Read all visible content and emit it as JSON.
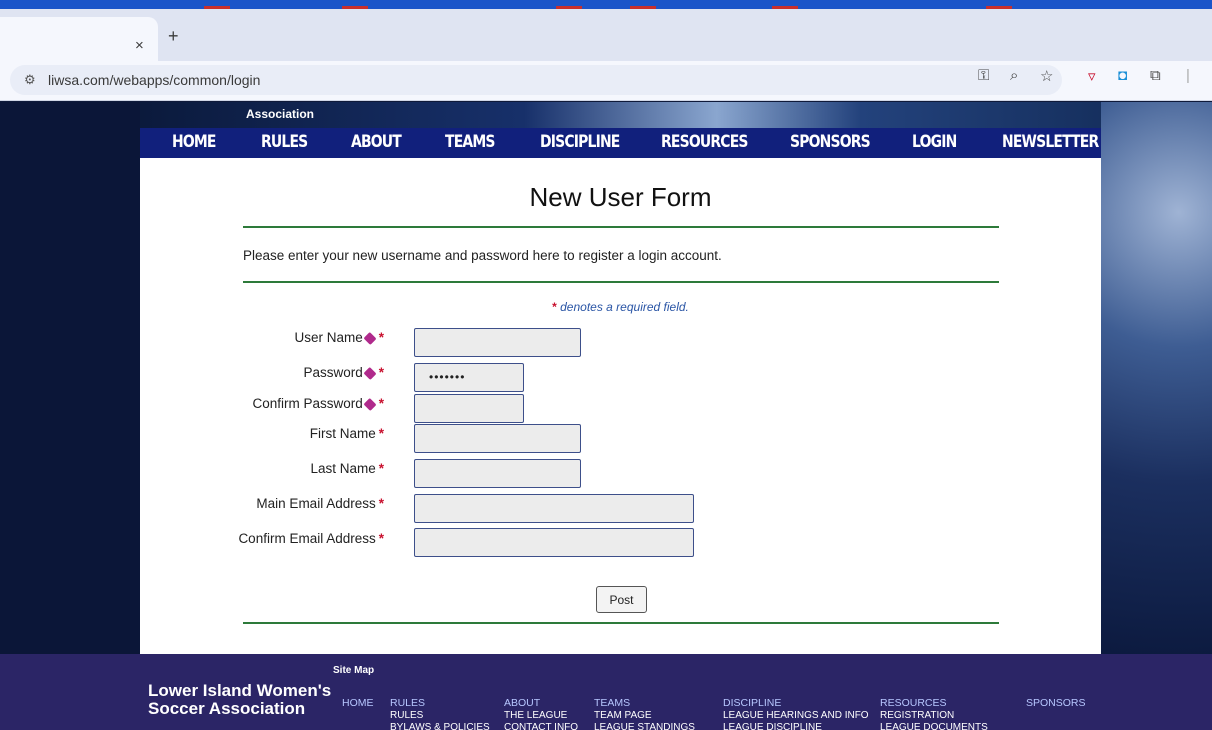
{
  "browser": {
    "url": "liwsa.com/webapps/common/login",
    "tab_close": "×",
    "tab_new": "+"
  },
  "banner": {
    "text": "Association"
  },
  "nav": [
    "HOME",
    "RULES",
    "ABOUT",
    "TEAMS",
    "DISCIPLINE",
    "RESOURCES",
    "SPONSORS",
    "LOGIN",
    "NEWSLETTER"
  ],
  "form": {
    "title": "New User Form",
    "intro": "Please enter your new username and password here to register a login account.",
    "required_note": "denotes a required field.",
    "required_marker": "*",
    "labels": {
      "username": "User Name",
      "password": "Password",
      "confirm_password": "Confirm Password",
      "first_name": "First Name",
      "last_name": "Last Name",
      "email": "Main Email Address",
      "confirm_email": "Confirm Email Address"
    },
    "values": {
      "username": "",
      "password": "•••••••",
      "confirm_password": "",
      "first_name": "",
      "last_name": "",
      "email": "",
      "confirm_email": ""
    },
    "submit": "Post"
  },
  "footer": {
    "site_map": "Site Map",
    "org_line1": "Lower Island Women's",
    "org_line2": "Soccer Association",
    "links": {
      "home": "HOME",
      "rules": "RULES",
      "about": "ABOUT",
      "teams": "TEAMS",
      "discipline": "DISCIPLINE",
      "resources": "RESOURCES",
      "sponsors": "SPONSORS"
    },
    "sub": {
      "rules_1": "RULES",
      "rules_2": "BYLAWS & POLICIES",
      "about_1": "THE LEAGUE",
      "about_2": "CONTACT INFO",
      "teams_1": "TEAM PAGE",
      "teams_2": "LEAGUE STANDINGS",
      "disc_1": "LEAGUE HEARINGS AND INFO",
      "disc_2": "LEAGUE DISCIPLINE",
      "res_1": "REGISTRATION",
      "res_2": "LEAGUE DOCUMENTS"
    }
  }
}
